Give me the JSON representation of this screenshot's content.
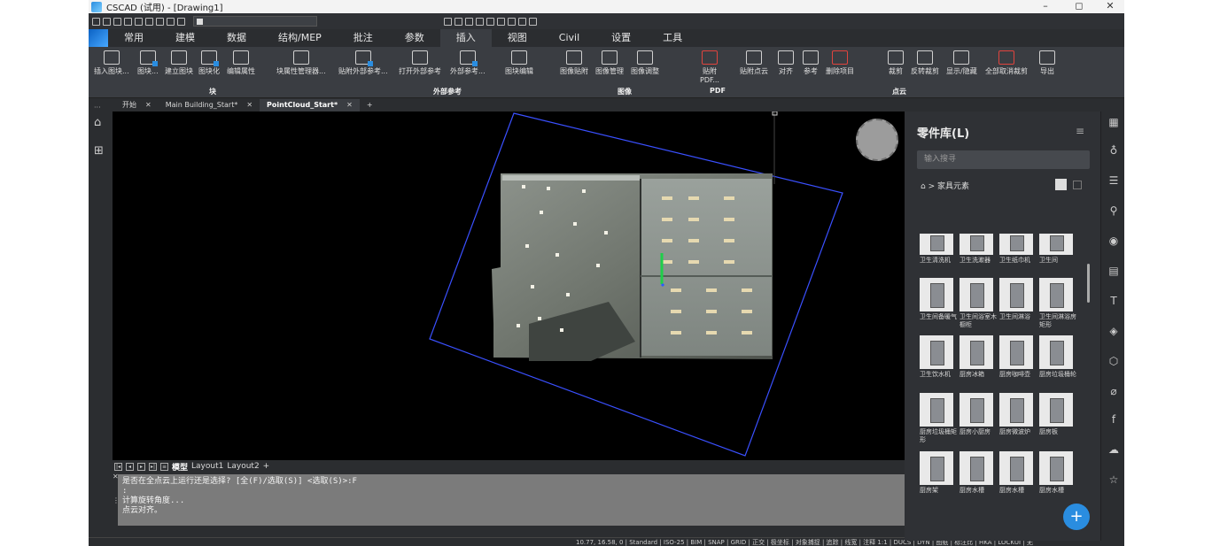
{
  "window": {
    "title": "CSCAD (试用) - [Drawing1]",
    "minimize": "–",
    "maximize": "◻",
    "close": "✕"
  },
  "ribbon": {
    "tabs": [
      "常用",
      "建模",
      "数据",
      "结构/MEP",
      "批注",
      "参数",
      "插入",
      "视图",
      "Civil",
      "设置",
      "工具"
    ],
    "active_tab": "插入",
    "buttons": [
      "插入图块...",
      "图块...",
      "建立图块",
      "图块化",
      "编辑属性",
      "块属性管理器...",
      "贴附外部参考...",
      "打开外部参考",
      "外部参考...",
      "图块编辑",
      "图像贴附",
      "图像管理",
      "图像调整",
      "贴附PDF...",
      "贴附点云",
      "对齐",
      "参考",
      "删除项目",
      "裁剪",
      "反转裁剪",
      "显示/隐藏",
      "全部取消裁剪",
      "导出"
    ],
    "groups": [
      "块",
      "外部参考",
      "图像",
      "PDF",
      "点云"
    ]
  },
  "doc_tabs": [
    {
      "label": "开始",
      "close": "✕"
    },
    {
      "label": "Main Building_Start*",
      "close": "✕"
    },
    {
      "label": "PointCloud_Start*",
      "close": "✕"
    }
  ],
  "doc_tab_add": "+",
  "layout_tabs": [
    "模型",
    "Layout1",
    "Layout2",
    "+"
  ],
  "command_lines": [
    "是否在全点云上运行还是选择? [全(F)/选取(S)] <选取(S)>:F",
    ":",
    "计算旋转角度...",
    "点云对齐。"
  ],
  "status_bar": "10.77, 16.58, 0 | Standard | ISO-25 | BIM | SNAP | GRID | 正交 | 极坐标 | 对象捕捉 | 追踪 | 线宽 | 注释 1:1 | DUCS | DYN | 图纸 | 标注比 | HKA | LOCKUI | 无",
  "library": {
    "title": "零件库(L)",
    "search_placeholder": "输入搜寻",
    "breadcrumb": "> 家具元素",
    "items": [
      "卫生清洗机",
      "卫生洗漱器",
      "卫生纸巾机",
      "卫生间",
      "卫生间备暖气",
      "卫生间浴室木橱柜",
      "卫生间淋浴",
      "卫生间淋浴房矩形",
      "卫生饮水机",
      "厨房冰箱",
      "厨房咖啡壶",
      "厨房垃圾桶轮",
      "厨房垃圾桶矩形",
      "厨房小厨房",
      "厨房微波炉",
      "厨房板",
      "厨房架",
      "厨房水槽",
      "厨房水槽",
      "厨房水槽"
    ],
    "add_button": "+"
  },
  "colors": {
    "accent": "#2a8de0",
    "boundary": "#3a50ff",
    "canvas": "#000000",
    "ribbon": "#3a3d42"
  }
}
